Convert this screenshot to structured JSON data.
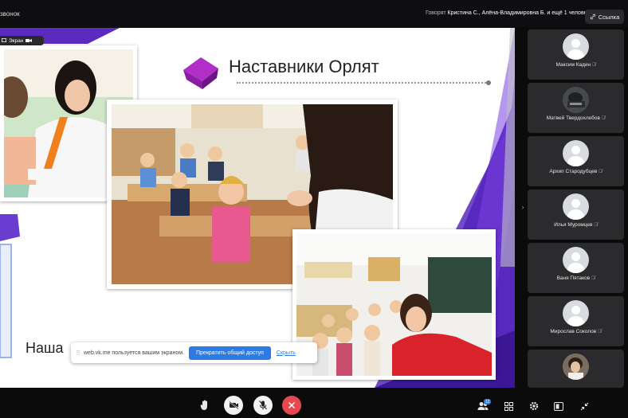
{
  "topbar": {
    "call_title": "звонок",
    "speaking_label": "Говорят",
    "speaking_names": "Кристина С., Алёна-Владимировна Б. и ещё 1 человек",
    "link_button": "Ссылка"
  },
  "stage": {
    "screen_badge": "Экран",
    "slide_title": "Наставники Орлят",
    "slide_footer_title": "Наша",
    "share_bar": {
      "message": "web.vk.me пользуется вашим экраном.",
      "stop_button": "Прекратить общий доступ",
      "hide_link": "Скрыть"
    }
  },
  "participants": [
    {
      "name": "Максим Кадин",
      "avatar": "default"
    },
    {
      "name": "Матвей Твердохлебов",
      "avatar": "photo"
    },
    {
      "name": "Архип Стародубцев",
      "avatar": "default"
    },
    {
      "name": "Илья Муромцев",
      "avatar": "default"
    },
    {
      "name": "Ваня Пятаков",
      "avatar": "default"
    },
    {
      "name": "Мирослав Соколов",
      "avatar": "default"
    },
    {
      "name": "",
      "avatar": "photo"
    }
  ],
  "toolbar": {
    "participants_count": "12",
    "icons": [
      "hand-icon",
      "camera-off-icon",
      "mic-off-icon",
      "end-call-icon",
      "participants-icon",
      "grid-icon",
      "settings-icon",
      "share-window-icon",
      "collapse-icon"
    ]
  },
  "colors": {
    "accent_purple": "#5b2bbf",
    "accent_blue": "#2c7be5",
    "end_call_red": "#e5484d",
    "tile_bg": "#2b2b2e"
  }
}
